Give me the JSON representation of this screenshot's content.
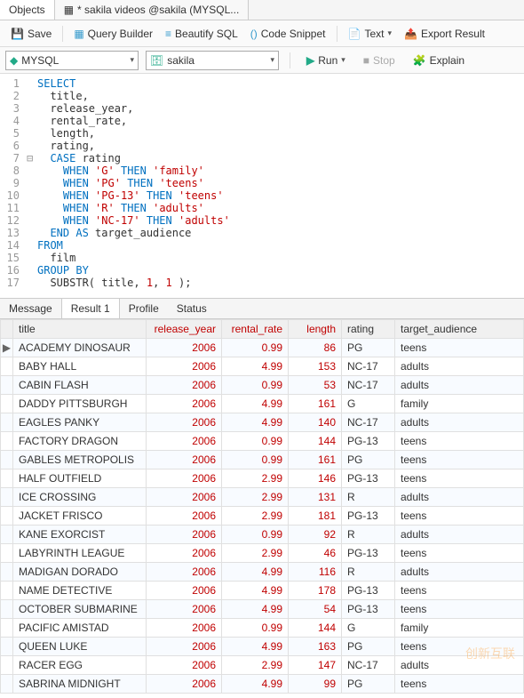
{
  "topTabs": {
    "objects": "Objects",
    "active": "* sakila videos @sakila (MYSQL..."
  },
  "toolbar": {
    "save": "Save",
    "qb": "Query Builder",
    "beautify": "Beautify SQL",
    "snippet": "Code Snippet",
    "text": "Text",
    "export": "Export Result"
  },
  "dbrow": {
    "engine": "MYSQL",
    "schema": "sakila",
    "run": "Run",
    "stop": "Stop",
    "explain": "Explain"
  },
  "sql": {
    "lines": [
      {
        "n": 1,
        "html": "<span class='kw'>SELECT</span>"
      },
      {
        "n": 2,
        "html": "  title,"
      },
      {
        "n": 3,
        "html": "  release_year,"
      },
      {
        "n": 4,
        "html": "  rental_rate,"
      },
      {
        "n": 5,
        "html": "  length,"
      },
      {
        "n": 6,
        "html": "  rating,"
      },
      {
        "n": 7,
        "fold": "⊟",
        "html": "  <span class='kw'>CASE</span> rating"
      },
      {
        "n": 8,
        "html": "    <span class='kw'>WHEN</span> <span class='str'>'G'</span> <span class='kw'>THEN</span> <span class='str'>'family'</span>"
      },
      {
        "n": 9,
        "html": "    <span class='kw'>WHEN</span> <span class='str'>'PG'</span> <span class='kw'>THEN</span> <span class='str'>'teens'</span>"
      },
      {
        "n": 10,
        "html": "    <span class='kw'>WHEN</span> <span class='str'>'PG-13'</span> <span class='kw'>THEN</span> <span class='str'>'teens'</span>"
      },
      {
        "n": 11,
        "html": "    <span class='kw'>WHEN</span> <span class='str'>'R'</span> <span class='kw'>THEN</span> <span class='str'>'adults'</span>"
      },
      {
        "n": 12,
        "html": "    <span class='kw'>WHEN</span> <span class='str'>'NC-17'</span> <span class='kw'>THEN</span> <span class='str'>'adults'</span>"
      },
      {
        "n": 13,
        "html": "  <span class='kw'>END AS</span> target_audience"
      },
      {
        "n": 14,
        "html": "<span class='kw'>FROM</span>"
      },
      {
        "n": 15,
        "html": "  film"
      },
      {
        "n": 16,
        "html": "<span class='kw'>GROUP BY</span>"
      },
      {
        "n": 17,
        "html": "  SUBSTR( title, <span class='num'>1</span>, <span class='num'>1</span> );"
      }
    ]
  },
  "resultTabs": {
    "message": "Message",
    "result": "Result 1",
    "profile": "Profile",
    "status": "Status"
  },
  "columns": [
    "title",
    "release_year",
    "rental_rate",
    "length",
    "rating",
    "target_audience"
  ],
  "rows": [
    {
      "mark": "▶",
      "title": "ACADEMY DINOSAUR",
      "release_year": 2006,
      "rental_rate": "0.99",
      "length": 86,
      "rating": "PG",
      "target_audience": "teens"
    },
    {
      "title": "BABY HALL",
      "release_year": 2006,
      "rental_rate": "4.99",
      "length": 153,
      "rating": "NC-17",
      "target_audience": "adults"
    },
    {
      "title": "CABIN FLASH",
      "release_year": 2006,
      "rental_rate": "0.99",
      "length": 53,
      "rating": "NC-17",
      "target_audience": "adults"
    },
    {
      "title": "DADDY PITTSBURGH",
      "release_year": 2006,
      "rental_rate": "4.99",
      "length": 161,
      "rating": "G",
      "target_audience": "family"
    },
    {
      "title": "EAGLES PANKY",
      "release_year": 2006,
      "rental_rate": "4.99",
      "length": 140,
      "rating": "NC-17",
      "target_audience": "adults"
    },
    {
      "title": "FACTORY DRAGON",
      "release_year": 2006,
      "rental_rate": "0.99",
      "length": 144,
      "rating": "PG-13",
      "target_audience": "teens"
    },
    {
      "title": "GABLES METROPOLIS",
      "release_year": 2006,
      "rental_rate": "0.99",
      "length": 161,
      "rating": "PG",
      "target_audience": "teens"
    },
    {
      "title": "HALF OUTFIELD",
      "release_year": 2006,
      "rental_rate": "2.99",
      "length": 146,
      "rating": "PG-13",
      "target_audience": "teens"
    },
    {
      "title": "ICE CROSSING",
      "release_year": 2006,
      "rental_rate": "2.99",
      "length": 131,
      "rating": "R",
      "target_audience": "adults"
    },
    {
      "title": "JACKET FRISCO",
      "release_year": 2006,
      "rental_rate": "2.99",
      "length": 181,
      "rating": "PG-13",
      "target_audience": "teens"
    },
    {
      "title": "KANE EXORCIST",
      "release_year": 2006,
      "rental_rate": "0.99",
      "length": 92,
      "rating": "R",
      "target_audience": "adults"
    },
    {
      "title": "LABYRINTH LEAGUE",
      "release_year": 2006,
      "rental_rate": "2.99",
      "length": 46,
      "rating": "PG-13",
      "target_audience": "teens"
    },
    {
      "title": "MADIGAN DORADO",
      "release_year": 2006,
      "rental_rate": "4.99",
      "length": 116,
      "rating": "R",
      "target_audience": "adults"
    },
    {
      "title": "NAME DETECTIVE",
      "release_year": 2006,
      "rental_rate": "4.99",
      "length": 178,
      "rating": "PG-13",
      "target_audience": "teens"
    },
    {
      "title": "OCTOBER SUBMARINE",
      "release_year": 2006,
      "rental_rate": "4.99",
      "length": 54,
      "rating": "PG-13",
      "target_audience": "teens"
    },
    {
      "title": "PACIFIC AMISTAD",
      "release_year": 2006,
      "rental_rate": "0.99",
      "length": 144,
      "rating": "G",
      "target_audience": "family"
    },
    {
      "title": "QUEEN LUKE",
      "release_year": 2006,
      "rental_rate": "4.99",
      "length": 163,
      "rating": "PG",
      "target_audience": "teens"
    },
    {
      "title": "RACER EGG",
      "release_year": 2006,
      "rental_rate": "2.99",
      "length": 147,
      "rating": "NC-17",
      "target_audience": "adults"
    },
    {
      "title": "SABRINA MIDNIGHT",
      "release_year": 2006,
      "rental_rate": "4.99",
      "length": 99,
      "rating": "PG",
      "target_audience": "teens"
    }
  ],
  "watermark": "创新互联"
}
